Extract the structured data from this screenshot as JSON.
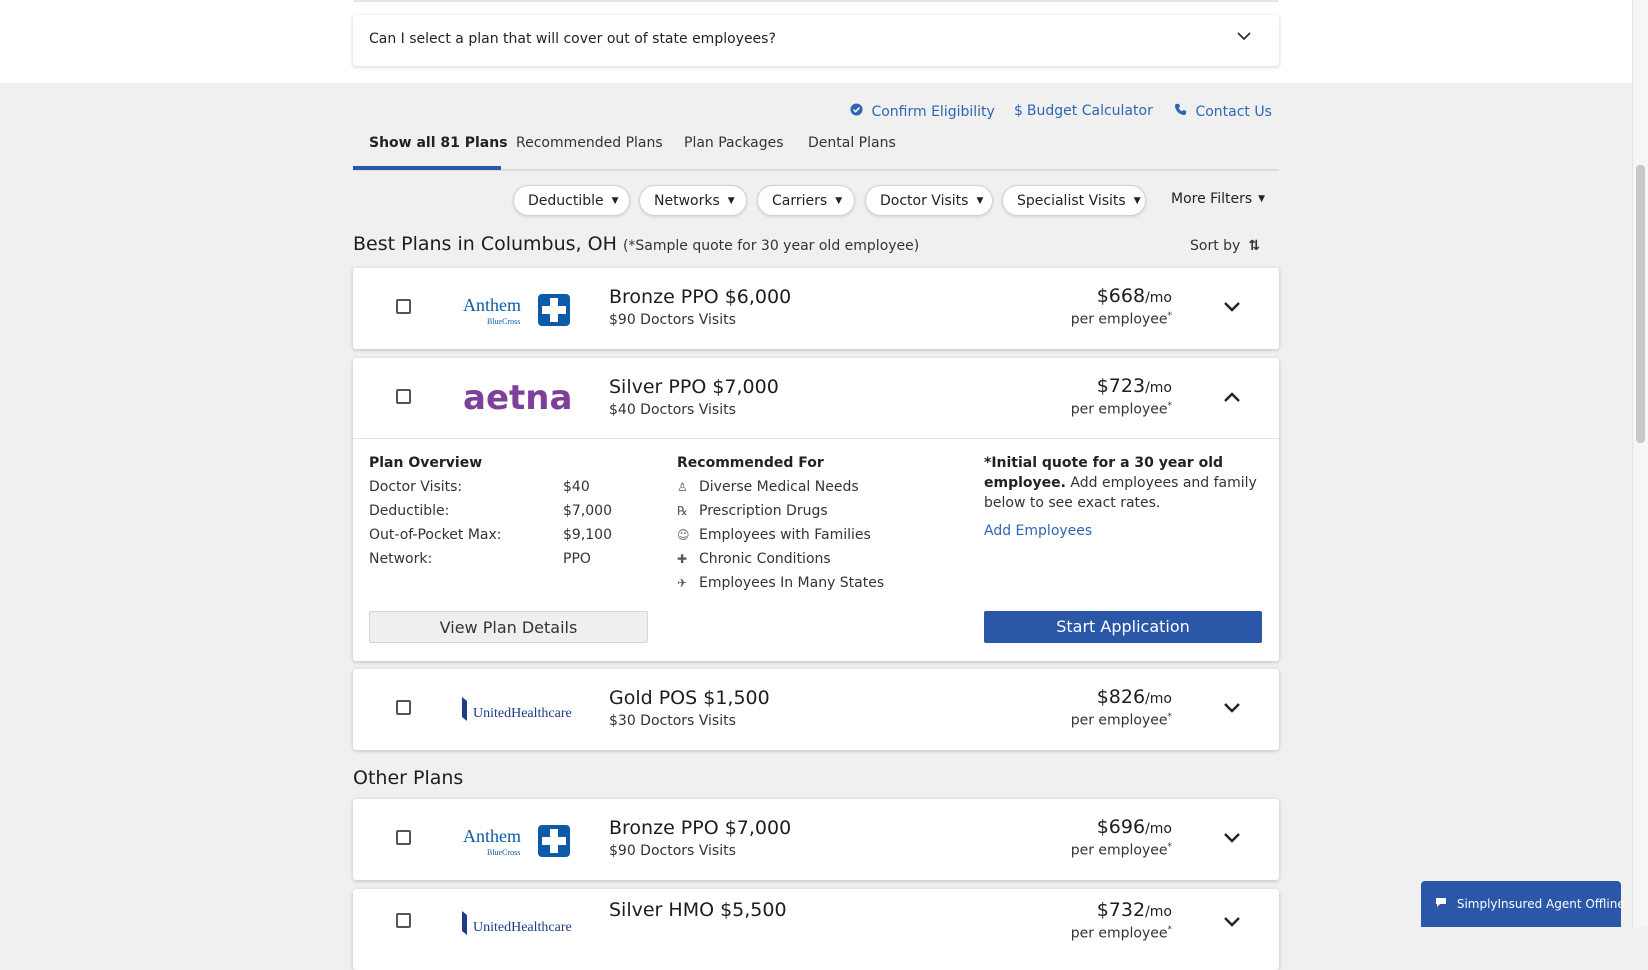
{
  "faq": {
    "question": "Can I select a plan that will cover out of state employees?"
  },
  "links": {
    "confirm_eligibility": "Confirm Eligibility",
    "budget_calculator": "Budget Calculator",
    "contact_us": "Contact Us"
  },
  "tabs": [
    {
      "label": "Show all 81 Plans",
      "active": true
    },
    {
      "label": "Recommended Plans"
    },
    {
      "label": "Plan Packages"
    },
    {
      "label": "Dental Plans"
    }
  ],
  "filters": [
    "Deductible",
    "Networks",
    "Carriers",
    "Doctor Visits",
    "Specialist Visits"
  ],
  "more_filters": "More Filters",
  "best_section": {
    "title": "Best Plans in Columbus, OH",
    "subtitle": "(*Sample quote for 30 year old employee)"
  },
  "sort_by": "Sort by",
  "other_section": {
    "title": "Other Plans"
  },
  "plans": [
    {
      "carrier": "Anthem BlueCross",
      "name": "Bronze PPO $6,000",
      "visits": "$90 Doctors Visits",
      "price": "$668",
      "unit": "/mo",
      "per": "per employee"
    },
    {
      "carrier": "aetna",
      "name": "Silver PPO $7,000",
      "visits": "$40 Doctors Visits",
      "price": "$723",
      "unit": "/mo",
      "per": "per employee"
    },
    {
      "carrier": "UnitedHealthcare",
      "name": "Gold POS $1,500",
      "visits": "$30 Doctors Visits",
      "price": "$826",
      "unit": "/mo",
      "per": "per employee"
    },
    {
      "carrier": "Anthem BlueCross",
      "name": "Bronze PPO $7,000",
      "visits": "$90 Doctors Visits",
      "price": "$696",
      "unit": "/mo",
      "per": "per employee"
    },
    {
      "carrier": "UnitedHealthcare",
      "name": "Silver HMO $5,500",
      "visits": "",
      "price": "$732",
      "unit": "/mo",
      "per": "per employee"
    }
  ],
  "expanded": {
    "overview_title": "Plan Overview",
    "overview": [
      {
        "label": "Doctor Visits:",
        "value": "$40"
      },
      {
        "label": "Deductible:",
        "value": "$7,000"
      },
      {
        "label": "Out-of-Pocket Max:",
        "value": "$9,100"
      },
      {
        "label": "Network:",
        "value": "PPO"
      }
    ],
    "recommended_title": "Recommended For",
    "recommended": [
      {
        "icon": "person-icon",
        "label": "Diverse Medical Needs"
      },
      {
        "icon": "prescription-icon",
        "label": "Prescription Drugs"
      },
      {
        "icon": "family-icon",
        "label": "Employees with Families"
      },
      {
        "icon": "medical-icon",
        "label": "Chronic Conditions"
      },
      {
        "icon": "plane-icon",
        "label": "Employees In Many States"
      }
    ],
    "note_bold": "*Initial quote for a 30 year old employee.",
    "note_text": "Add employees and family below to see exact rates.",
    "add_employees": "Add Employees",
    "view_details": "View Plan Details",
    "start_application": "Start Application"
  },
  "chat": {
    "label": "SimplyInsured Agent Offline"
  },
  "colors": {
    "accent": "#2a57a8",
    "link": "#2f66b3",
    "aetna": "#7d3f98",
    "anthem": "#0b5ba8"
  }
}
